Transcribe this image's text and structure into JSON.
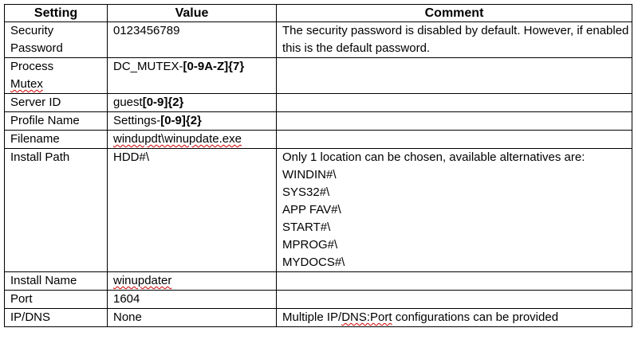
{
  "headers": {
    "setting": "Setting",
    "value": "Value",
    "comment": "Comment"
  },
  "rows": {
    "security_password": {
      "setting_line1": "Security",
      "setting_line2": "Password",
      "value": "0123456789",
      "comment": "The security password is disabled by default. However, if enabled this is the default password."
    },
    "process_mutex": {
      "setting_line1": "Process",
      "setting_line2": "Mutex",
      "value_prefix": "DC_MUTEX-",
      "value_pattern": "[0-9A-Z]{7}"
    },
    "server_id": {
      "setting": "Server ID",
      "value_prefix": "guest",
      "value_pattern": "[0-9]{2}"
    },
    "profile_name": {
      "setting": "Profile Name",
      "value_prefix": "Settings-",
      "value_pattern": "[0-9]{2}"
    },
    "filename": {
      "setting": "Filename",
      "value": "windupdt\\winupdate.exe"
    },
    "install_path": {
      "setting": "Install Path",
      "value": "HDD#\\",
      "comment_intro": "Only 1 location can be chosen, available alternatives are:",
      "alternatives": [
        "WINDIN#\\",
        "SYS32#\\",
        "APP FAV#\\",
        "START#\\",
        "MPROG#\\",
        "MYDOCS#\\"
      ]
    },
    "install_name": {
      "setting": "Install Name",
      "value": "winupdater"
    },
    "port": {
      "setting": "Port",
      "value": "1604"
    },
    "ip_dns": {
      "setting": "IP/DNS",
      "value": "None",
      "comment_prefix": "Multiple IP/",
      "comment_dns": "DNS:Port",
      "comment_suffix": " configurations can be provided"
    }
  }
}
